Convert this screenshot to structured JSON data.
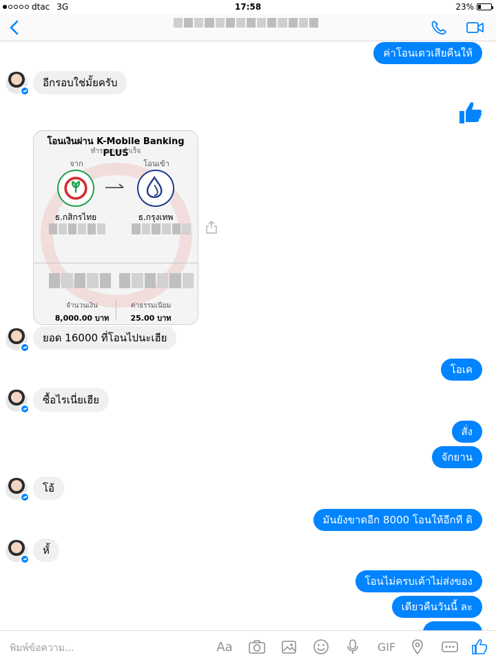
{
  "status_bar": {
    "carrier": "dtac",
    "network": "3G",
    "time": "17:58",
    "battery": "23%",
    "battery_level": 0.23
  },
  "header": {
    "back_icon": "chevron-left-icon",
    "call_icon": "phone-icon",
    "video_icon": "video-camera-icon",
    "accent_color": "#0084ff"
  },
  "messages": {
    "m1": "ค่าโอนเดวเสียคืนให้",
    "m2": "อีกรอบใช่มั้ยครับ",
    "m4": "ยอด 16000 ที่โอนไปนะเฮีย",
    "m5": "โอเค",
    "m6": "ซื้อไรเนี่ยเฮีย",
    "m7": "สั่ง",
    "m8": "จักยาน",
    "m9": "โอ้",
    "m10": "มันยังขาดอีก 8000 โอนให้อีกที ดิ",
    "m11": "หั้",
    "m12": "โอนไม่ครบเค้าไม่ส่งของ",
    "m13": "เดียวคืนวันนี้ ละ"
  },
  "receipt": {
    "title": "โอนเงินผ่าน K-Mobile Banking PLUS",
    "subtitle": "ทำรายการสำเร็จ",
    "from_label": "จาก",
    "to_label": "โอนเข้า",
    "from_bank": "ธ.กสิกรไทย",
    "to_bank": "ธ.กรุงเทพ",
    "amount_label": "จำนวนเงิน",
    "amount_value": "8,000.00 บาท",
    "fee_label": "ค่าธรรมเนียม",
    "fee_value": "25.00 บาท"
  },
  "composer": {
    "placeholder": "พิมพ์ข้อความ...",
    "text_format_label": "Aa",
    "gif_label": "GIF",
    "icons": [
      "camera-icon",
      "photo-icon",
      "emoji-icon",
      "microphone-icon",
      "location-icon",
      "more-icon",
      "like-icon"
    ]
  }
}
